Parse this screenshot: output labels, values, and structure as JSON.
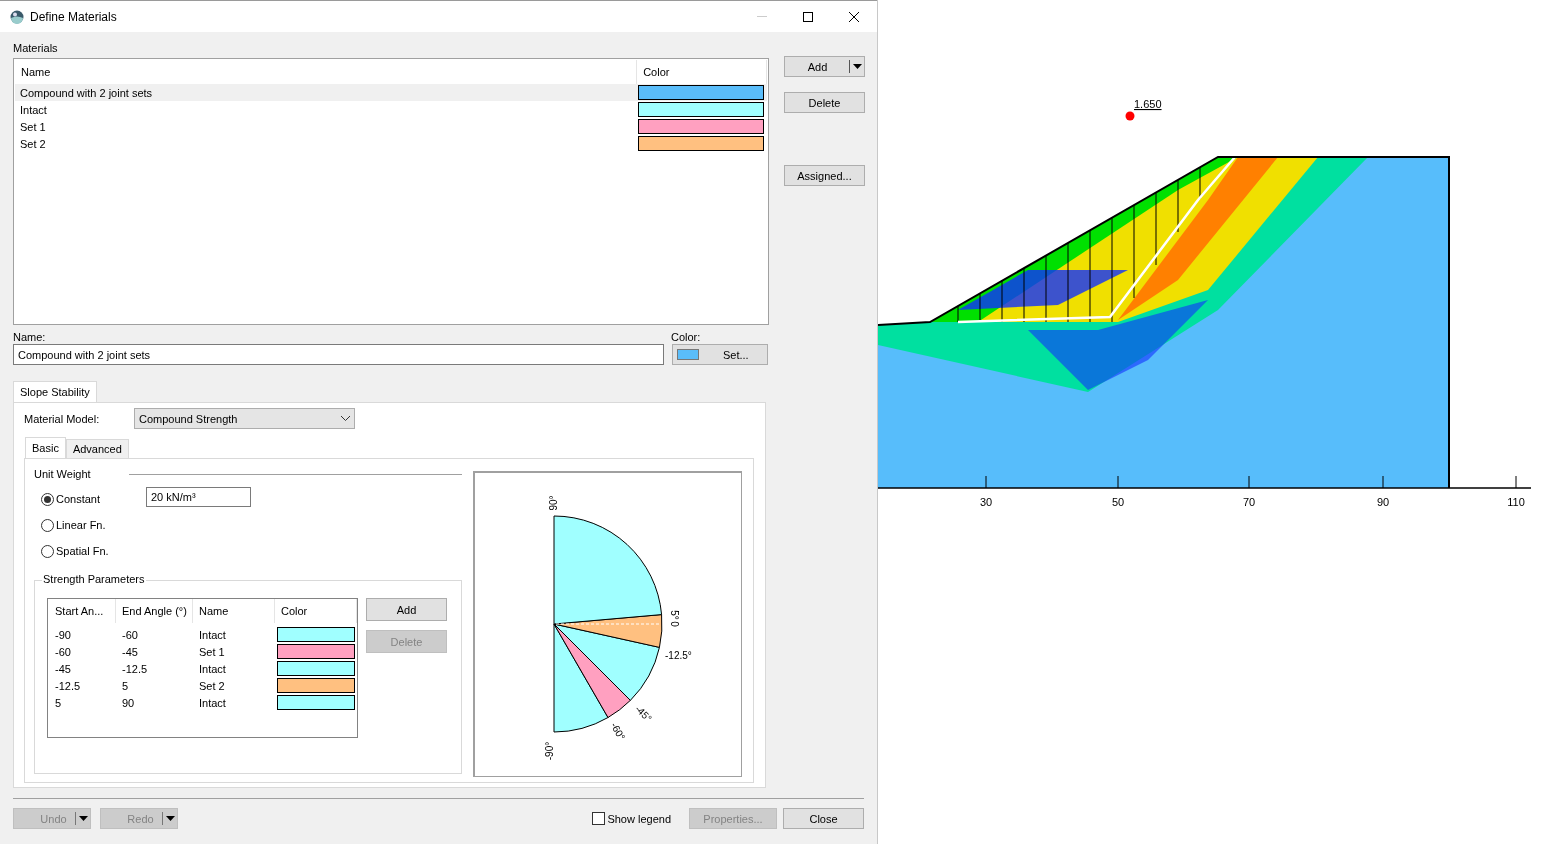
{
  "window": {
    "title": "Define Materials"
  },
  "materials": {
    "label": "Materials",
    "columns": [
      "Name",
      "Color"
    ],
    "rows": [
      {
        "name": "Compound with 2 joint sets",
        "color": "#5abdfa",
        "selected": true
      },
      {
        "name": "Intact",
        "color": "#a0ffff",
        "selected": false
      },
      {
        "name": "Set 1",
        "color": "#ffa0c0",
        "selected": false
      },
      {
        "name": "Set 2",
        "color": "#ffc080",
        "selected": false
      }
    ]
  },
  "material_buttons": [
    {
      "label": "Add",
      "kind": "split"
    },
    {
      "label": "Delete",
      "kind": "plain"
    },
    {
      "label": "Assigned...",
      "kind": "plain"
    }
  ],
  "name_field": {
    "label": "Name:",
    "value": "Compound with 2 joint sets"
  },
  "color_field": {
    "label": "Color:",
    "color": "#5abdfa",
    "button": "Set..."
  },
  "tabs": [
    {
      "label": "Slope Stability",
      "selected": true
    }
  ],
  "material_model": {
    "label": "Material Model:",
    "value": "Compound Strength"
  },
  "subtabs": [
    {
      "label": "Basic",
      "selected": true
    },
    {
      "label": "Advanced",
      "selected": false
    }
  ],
  "unit_weight": {
    "title": "Unit Weight",
    "value": "20 kN/m³",
    "options": [
      {
        "label": "Constant",
        "selected": true
      },
      {
        "label": "Linear Fn.",
        "selected": false
      },
      {
        "label": "Spatial Fn.",
        "selected": false
      }
    ]
  },
  "strength_parameters": {
    "title": "Strength Parameters",
    "columns": [
      "Start An...",
      "End Angle (°)",
      "Name",
      "Color"
    ],
    "rows": [
      {
        "start": "-90",
        "end": "-60",
        "name": "Intact",
        "color": "#a0ffff"
      },
      {
        "start": "-60",
        "end": "-45",
        "name": "Set 1",
        "color": "#ffa0c0"
      },
      {
        "start": "-45",
        "end": "-12.5",
        "name": "Intact",
        "color": "#a0ffff"
      },
      {
        "start": "-12.5",
        "end": "5",
        "name": "Set 2",
        "color": "#ffc080"
      },
      {
        "start": "5",
        "end": "90",
        "name": "Intact",
        "color": "#a0ffff"
      }
    ],
    "buttons": [
      {
        "label": "Add",
        "disabled": false
      },
      {
        "label": "Delete",
        "disabled": true
      }
    ]
  },
  "diagram": {
    "labels": [
      "90°",
      "5°",
      "0",
      "-12.5°",
      "-45°",
      "-60°",
      "-90°"
    ]
  },
  "footer": {
    "undo": {
      "label": "Undo",
      "disabled": true
    },
    "redo": {
      "label": "Redo",
      "disabled": true
    },
    "show_legend": {
      "label": "Show legend",
      "checked": false
    },
    "properties": {
      "label": "Properties...",
      "disabled": true
    },
    "close": {
      "label": "Close",
      "disabled": false
    }
  },
  "model_view": {
    "factor_of_safety": "1.650",
    "axis_labels": [
      "30",
      "50",
      "70",
      "90",
      "110"
    ]
  }
}
